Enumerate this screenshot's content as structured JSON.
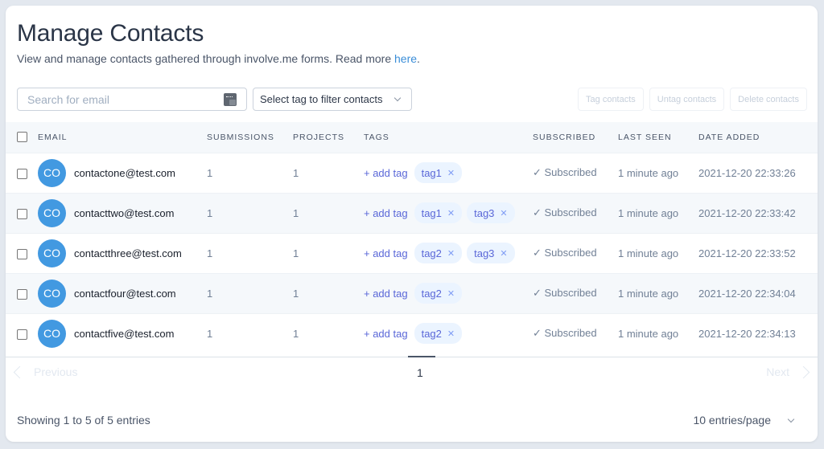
{
  "header": {
    "title": "Manage Contacts",
    "subtitle_prefix": "View and manage contacts gathered through involve.me forms. Read more ",
    "subtitle_link": "here",
    "subtitle_suffix": "."
  },
  "toolbar": {
    "search_placeholder": "Search for email",
    "search_value": "",
    "tag_filter_label": "Select tag to filter contacts",
    "tag_button": "Tag contacts",
    "untag_button": "Untag contacts",
    "delete_button": "Delete contacts"
  },
  "table": {
    "columns": [
      "Email",
      "Submissions",
      "Projects",
      "Tags",
      "Subscribed",
      "Last seen",
      "Date added"
    ],
    "add_tag_label": "+ add tag",
    "rows": [
      {
        "initials": "CO",
        "email": "contactone@test.com",
        "submissions": "1",
        "projects": "1",
        "tags": [
          "tag1"
        ],
        "subscribed": "✓ Subscribed",
        "last_seen": "1 minute ago",
        "date_added": "2021-12-20 22:33:26"
      },
      {
        "initials": "CO",
        "email": "contacttwo@test.com",
        "submissions": "1",
        "projects": "1",
        "tags": [
          "tag1",
          "tag3"
        ],
        "subscribed": "✓ Subscribed",
        "last_seen": "1 minute ago",
        "date_added": "2021-12-20 22:33:42"
      },
      {
        "initials": "CO",
        "email": "contactthree@test.com",
        "submissions": "1",
        "projects": "1",
        "tags": [
          "tag2",
          "tag3"
        ],
        "subscribed": "✓ Subscribed",
        "last_seen": "1 minute ago",
        "date_added": "2021-12-20 22:33:52"
      },
      {
        "initials": "CO",
        "email": "contactfour@test.com",
        "submissions": "1",
        "projects": "1",
        "tags": [
          "tag2"
        ],
        "subscribed": "✓ Subscribed",
        "last_seen": "1 minute ago",
        "date_added": "2021-12-20 22:34:04"
      },
      {
        "initials": "CO",
        "email": "contactfive@test.com",
        "submissions": "1",
        "projects": "1",
        "tags": [
          "tag2"
        ],
        "subscribed": "✓ Subscribed",
        "last_seen": "1 minute ago",
        "date_added": "2021-12-20 22:34:13"
      }
    ]
  },
  "pagination": {
    "previous": "Previous",
    "next": "Next",
    "current_page": "1",
    "showing": "Showing 1 to 5 of 5 entries",
    "per_page": "10 entries/page"
  },
  "colors": {
    "avatar": "#4299e1",
    "link": "#3b8ed8",
    "tag_bg": "#ebf4ff",
    "tag_text": "#5a67d8"
  }
}
